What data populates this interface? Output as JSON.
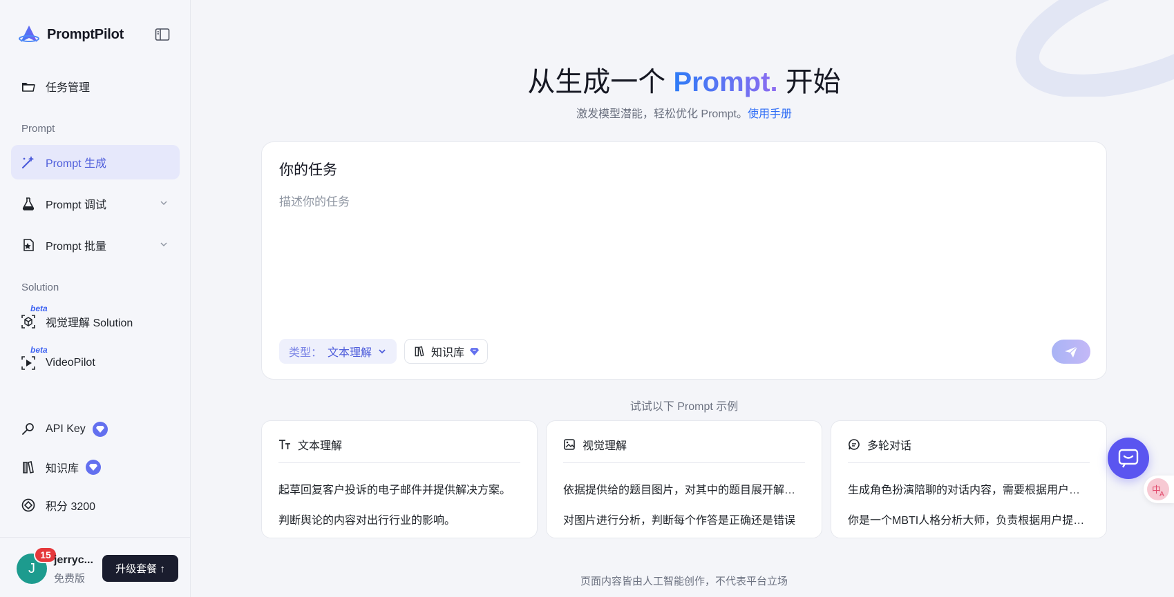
{
  "brand": {
    "name": "PromptPilot"
  },
  "sidebar": {
    "task_management": "任务管理",
    "section_prompt": "Prompt",
    "prompt_generate": "Prompt 生成",
    "prompt_debug": "Prompt 调试",
    "prompt_batch": "Prompt 批量",
    "section_solution": "Solution",
    "beta_label": "beta",
    "vision_solution": "视觉理解 Solution",
    "videopilot": "VideoPilot",
    "api_key": "API Key",
    "knowledge_base": "知识库",
    "points": "积分 3200"
  },
  "user": {
    "avatar_letter": "J",
    "notification_count": "15",
    "name": "jerryc...",
    "plan": "免费版",
    "upgrade_label": "升级套餐 ↑"
  },
  "hero": {
    "title_prefix": "从生成一个 ",
    "title_accent": "Prompt.",
    "title_suffix": " 开始",
    "subtitle": "激发模型潜能，轻松优化 Prompt。",
    "manual_link": "使用手册"
  },
  "task": {
    "label": "你的任务",
    "placeholder": "描述你的任务",
    "value": "",
    "type_key": "类型：",
    "type_value": "文本理解",
    "knowledge_label": "知识库"
  },
  "examples": {
    "hint": "试试以下 Prompt 示例",
    "cards": [
      {
        "title": "文本理解",
        "icon": "text-size-icon",
        "lines": [
          "起草回复客户投诉的电子邮件并提供解决方案。",
          "判断舆论的内容对出行行业的影响。"
        ]
      },
      {
        "title": "视觉理解",
        "icon": "image-icon",
        "lines": [
          "依据提供给的题目图片，对其中的题目展开解答并给出答案和解析",
          "对图片进行分析，判断每个作答是正确还是错误"
        ]
      },
      {
        "title": "多轮对话",
        "icon": "chat-bubble-icon",
        "lines": [
          "生成角色扮演陪聊的对话内容，需要根据用户的设定进行回复",
          "你是一个MBTI人格分析大师，负责根据用户提供的信息进行分析"
        ]
      }
    ]
  },
  "footer": {
    "note": "页面内容皆由人工智能创作，不代表平台立场"
  },
  "colors": {
    "accent": "#4e5ddb",
    "badge": "#e5383b",
    "fab": "#5a55f0",
    "avatar": "#1d9b8e"
  }
}
